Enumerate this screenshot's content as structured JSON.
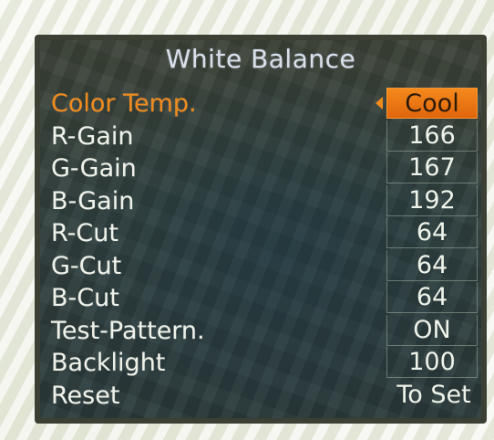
{
  "menu": {
    "title": "White Balance",
    "items": [
      {
        "label": "Color Temp.",
        "value": "Cool"
      },
      {
        "label": "R-Gain",
        "value": "166"
      },
      {
        "label": "G-Gain",
        "value": "167"
      },
      {
        "label": "B-Gain",
        "value": "192"
      },
      {
        "label": "R-Cut",
        "value": "64"
      },
      {
        "label": "G-Cut",
        "value": "64"
      },
      {
        "label": "B-Cut",
        "value": "64"
      },
      {
        "label": "Test-Pattern.",
        "value": "ON"
      },
      {
        "label": "Backlight",
        "value": "100"
      },
      {
        "label": "Reset",
        "value": "To Set"
      }
    ]
  },
  "colors": {
    "highlight": "#f08a1c",
    "text": "#eef3ea",
    "panel": "#32413f"
  }
}
